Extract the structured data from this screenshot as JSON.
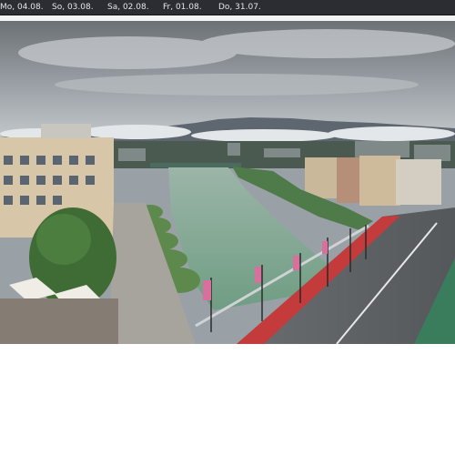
{
  "date_bar": {
    "tabs": [
      {
        "label": "Mo, 04.08."
      },
      {
        "label": "So, 03.08."
      },
      {
        "label": "Sa, 02.08."
      },
      {
        "label": "Fr, 01.08."
      },
      {
        "label": "Do, 31.07."
      }
    ]
  },
  "webcam": {
    "image_description_icon": "panorama-image"
  },
  "colors": {
    "date_bar_bg": "#2b2d33",
    "date_text": "#e6e6e6",
    "river": "#7fa890",
    "sky": "#8f969b",
    "red_lane": "#c43b3b"
  }
}
